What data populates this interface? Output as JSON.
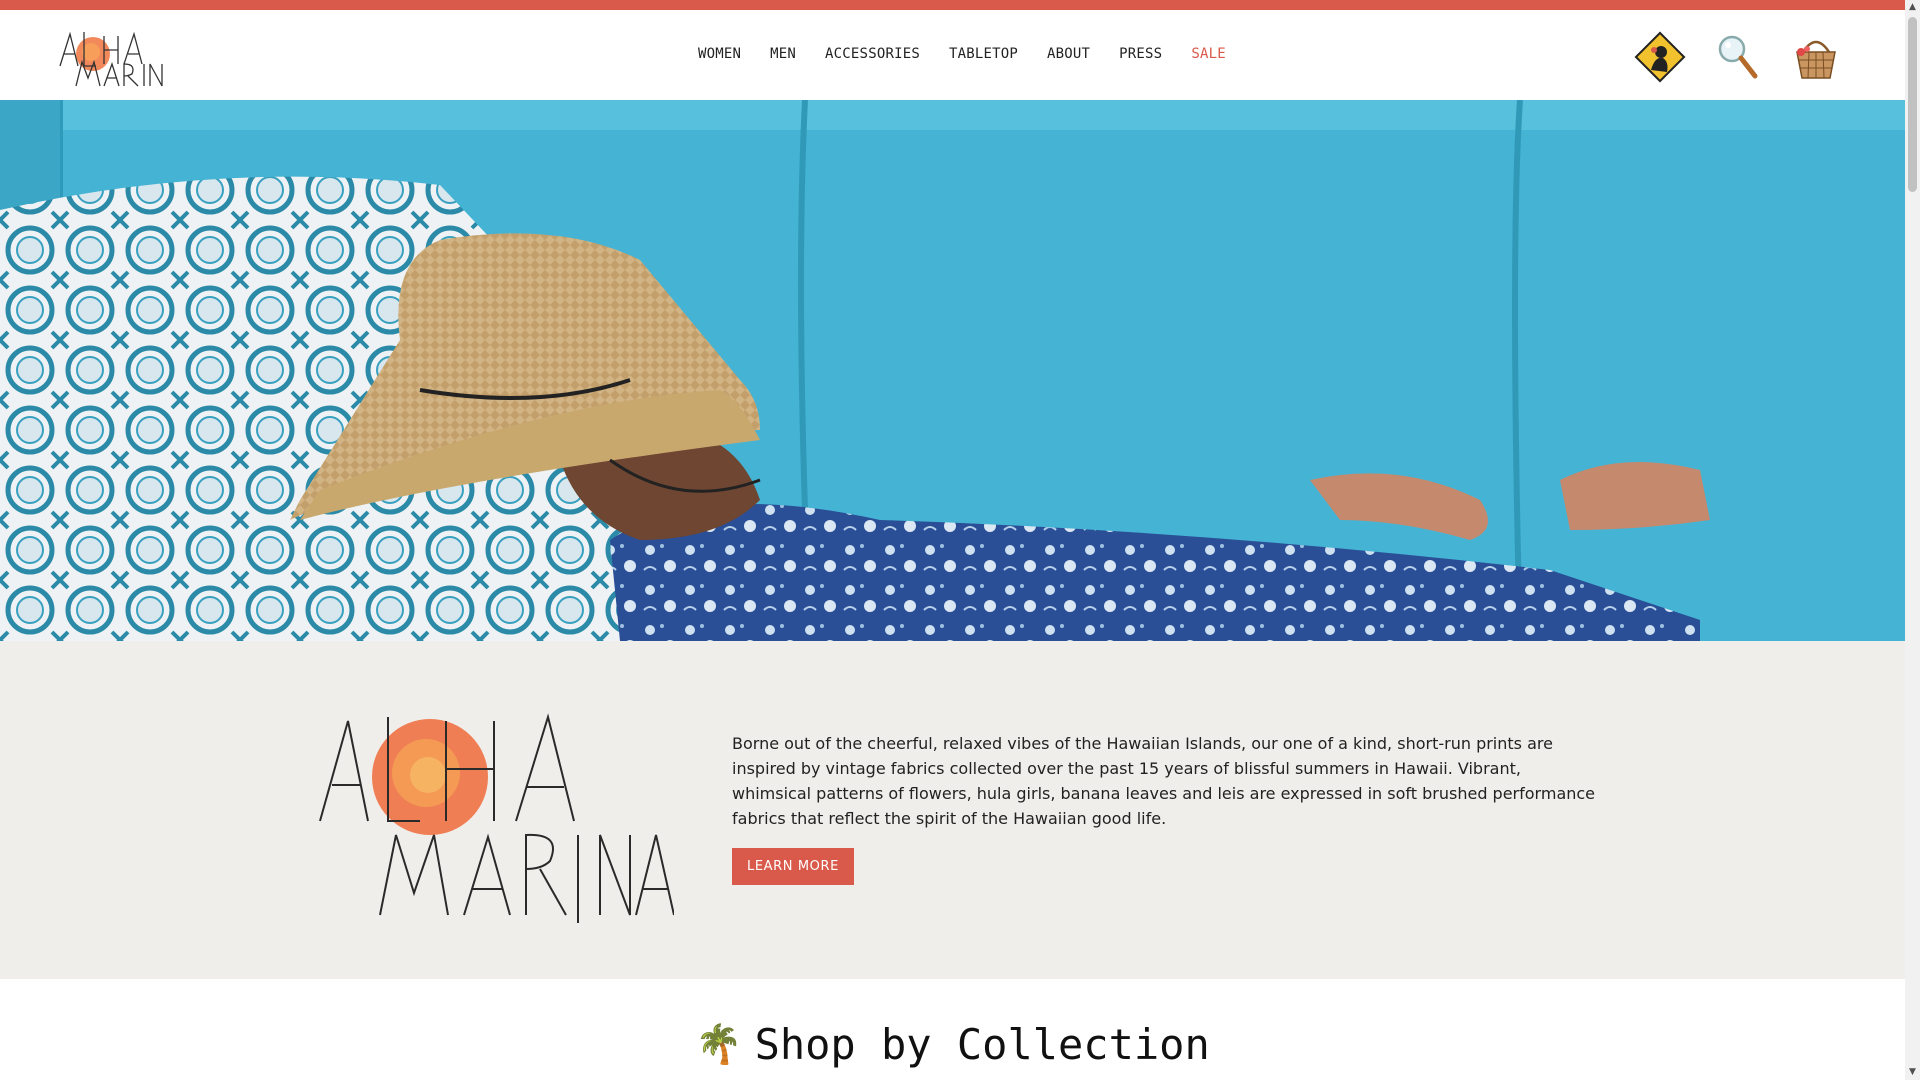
{
  "brand": {
    "logo_text_line1": "ALOHA",
    "logo_text_line2": "MARINA",
    "accent_color": "#d9594a"
  },
  "nav": {
    "items": [
      {
        "label": "WOMEN"
      },
      {
        "label": "MEN"
      },
      {
        "label": "ACCESSORIES"
      },
      {
        "label": "TABLETOP"
      },
      {
        "label": "ABOUT"
      },
      {
        "label": "PRESS"
      },
      {
        "label": "SALE"
      }
    ]
  },
  "header_icons": [
    {
      "name": "account-icon"
    },
    {
      "name": "search-icon"
    },
    {
      "name": "cart-basket-icon"
    }
  ],
  "hero": {
    "image": "man-in-straw-hat-sleeping-on-blue-couch"
  },
  "intro": {
    "description": "Borne out of the cheerful, relaxed vibes of the Hawaiian Islands, our one of a kind, short-run prints are inspired by vintage fabrics collected over the past 15 years of blissful summers in Hawaii. Vibrant, whimsical patterns of flowers, hula girls, banana leaves and leis are expressed in soft brushed performance fabrics that reflect the spirit of the Hawaiian good life.",
    "button_label": "LEARN MORE"
  },
  "shop": {
    "heading": "Shop by Collection",
    "heading_icon": "🌴"
  }
}
